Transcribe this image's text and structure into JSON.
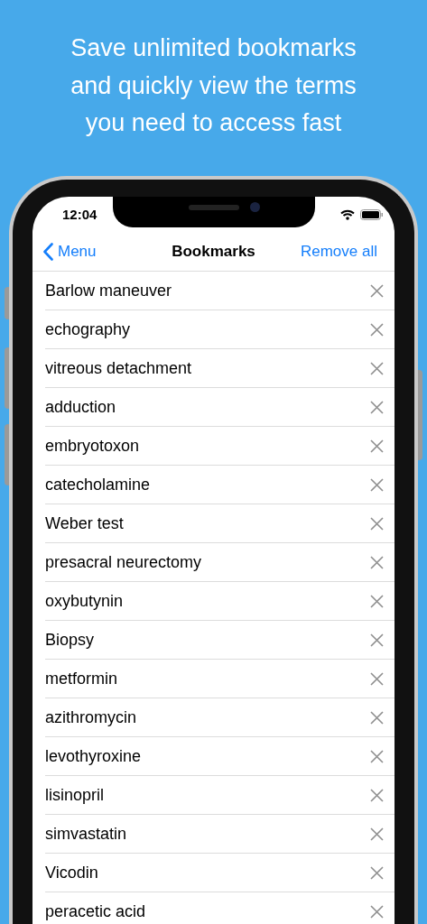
{
  "headline": {
    "lines": [
      "Save unlimited bookmarks",
      "and quickly view the terms",
      "you need to access fast"
    ]
  },
  "status_bar": {
    "time": "12:04"
  },
  "nav": {
    "back": "Menu",
    "title": "Bookmarks",
    "action": "Remove all"
  },
  "bookmarks": [
    {
      "term": "Barlow maneuver"
    },
    {
      "term": "echography"
    },
    {
      "term": "vitreous detachment"
    },
    {
      "term": "adduction"
    },
    {
      "term": "embryotoxon"
    },
    {
      "term": "catecholamine"
    },
    {
      "term": "Weber test"
    },
    {
      "term": "presacral neurectomy"
    },
    {
      "term": "oxybutynin"
    },
    {
      "term": "Biopsy"
    },
    {
      "term": "metformin"
    },
    {
      "term": "azithromycin"
    },
    {
      "term": "levothyroxine"
    },
    {
      "term": "lisinopril"
    },
    {
      "term": "simvastatin"
    },
    {
      "term": "Vicodin"
    },
    {
      "term": "peracetic acid"
    }
  ]
}
